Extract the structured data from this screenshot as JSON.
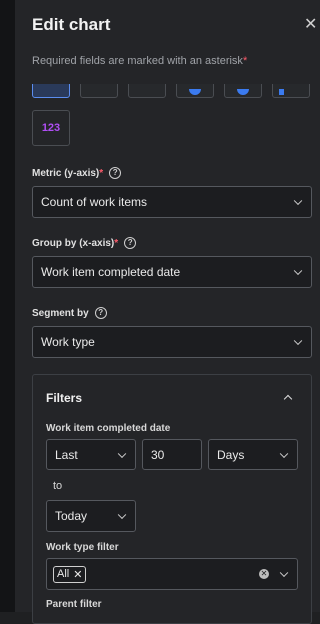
{
  "dialog": {
    "title": "Edit chart",
    "close_glyph": "✕",
    "required_note": "Required fields are marked with an asterisk",
    "required_star": "*"
  },
  "chart_types": {
    "number_label": "123"
  },
  "metric": {
    "label": "Metric (y-axis)",
    "star": "*",
    "help_glyph": "?",
    "value": "Count of work items"
  },
  "group_by": {
    "label": "Group by (x-axis)",
    "star": "*",
    "help_glyph": "?",
    "value": "Work item completed date"
  },
  "segment_by": {
    "label": "Segment by",
    "help_glyph": "?",
    "value": "Work type"
  },
  "filters": {
    "title": "Filters",
    "completed_date": {
      "label": "Work item completed date",
      "range": "Last",
      "amount": "30",
      "unit": "Days",
      "to_label": "to",
      "end": "Today"
    },
    "work_type": {
      "label": "Work type filter",
      "chip": "All",
      "chip_remove": "✕",
      "clear_glyph": "✕"
    },
    "parent": {
      "label": "Parent filter"
    }
  },
  "colors": {
    "accent": "#3b7bf0",
    "number_chart": "#b04ef5",
    "required": "#ff5c6c"
  }
}
